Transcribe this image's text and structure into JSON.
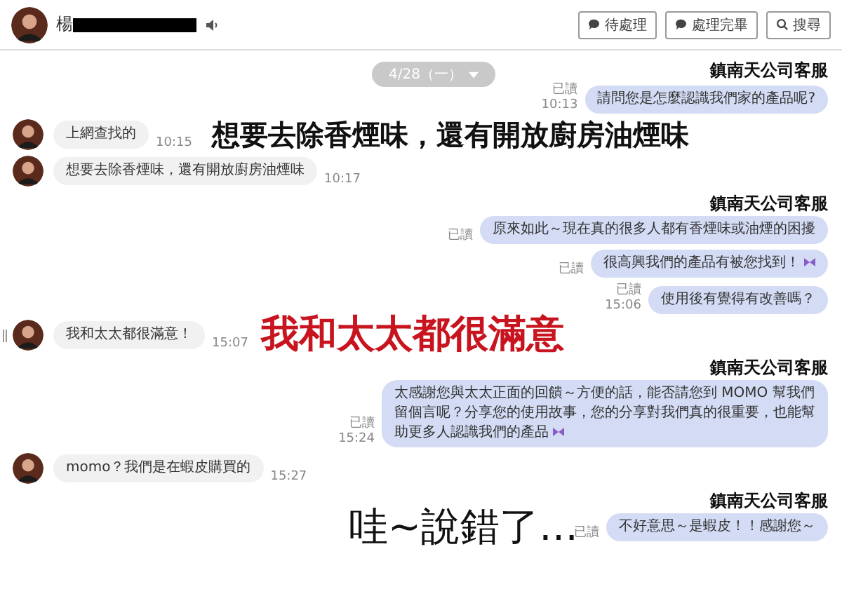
{
  "header": {
    "contact_name": "楊",
    "buttons": [
      {
        "label": "待處理"
      },
      {
        "label": "處理完畢"
      },
      {
        "label": "搜尋"
      }
    ]
  },
  "date_pill": {
    "label": "4/28（一）"
  },
  "messages": [
    {
      "kind": "sender",
      "text": "鎮南天公司客服"
    },
    {
      "kind": "out",
      "text": "請問您是怎麼認識我們家的產品呢?",
      "read": "已讀",
      "time": "10:13"
    },
    {
      "kind": "in",
      "text": "上網查找的",
      "time": "10:15",
      "annotation": {
        "text": "想要去除香煙味，還有開放廚房油煙味",
        "color": "#111111",
        "kind": "emphasis"
      }
    },
    {
      "kind": "in",
      "text": "想要去除香煙味，還有開放廚房油煙味",
      "time": "10:17"
    },
    {
      "kind": "sender",
      "text": "鎮南天公司客服"
    },
    {
      "kind": "out",
      "text": "原來如此～現在真的很多人都有香煙味或油煙的困擾",
      "read": "已讀"
    },
    {
      "kind": "out",
      "text": "很高興我們的產品有被您找到！",
      "read": "已讀",
      "sticker": true
    },
    {
      "kind": "out",
      "text": "使用後有覺得有改善嗎？",
      "read": "已讀",
      "time": "15:06"
    },
    {
      "kind": "in",
      "text": "我和太太都很滿意！",
      "time": "15:07",
      "grip": true,
      "annotation": {
        "text": "我和太太都很滿意",
        "color": "#c8141e",
        "kind": "emphasis"
      }
    },
    {
      "kind": "sender",
      "text": "鎮南天公司客服"
    },
    {
      "kind": "out",
      "text": "太感謝您與太太正面的回饋～方便的話，能否請您到 MOMO 幫我們留個言呢？分享您的使用故事，您的分享對我們真的很重要，也能幫助更多人認識我們的產品",
      "read": "已讀",
      "time": "15:24",
      "sticker": true
    },
    {
      "kind": "in",
      "text": "momo？我們是在蝦皮購買的",
      "time": "15:27"
    },
    {
      "kind": "sender",
      "text": "鎮南天公司客服"
    },
    {
      "kind": "out",
      "text": "不好意思～是蝦皮！！感謝您～",
      "read": "已讀",
      "annotation": {
        "text": "哇~說錯了…",
        "color": "#111111",
        "kind": "remark"
      }
    }
  ]
}
